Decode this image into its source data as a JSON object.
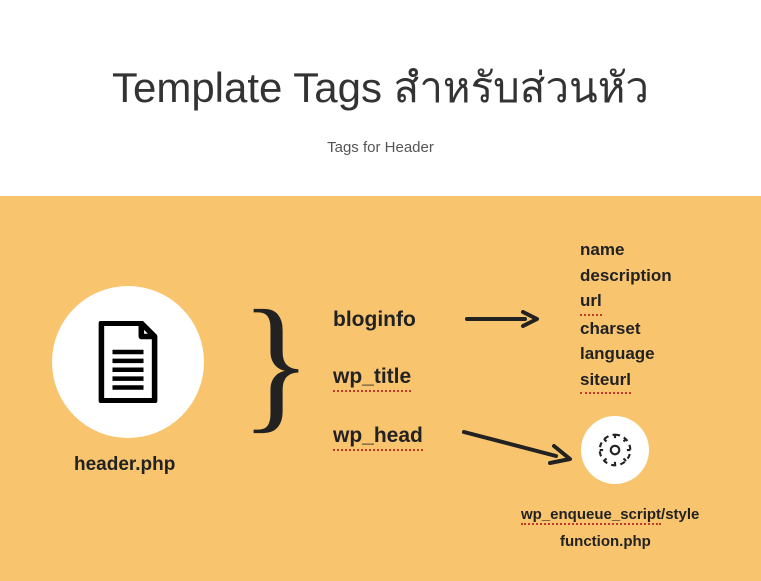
{
  "title": "Template Tags สำหรับส่วนหัว",
  "subtitle": "Tags for Header",
  "file_label": "header.php",
  "tags": {
    "bloginfo": "bloginfo",
    "wp_title": "wp_title",
    "wp_head": "wp_head"
  },
  "bloginfo_params": {
    "name": "name",
    "description": "description",
    "url": "url",
    "charset": "charset",
    "language": "language",
    "siteurl": "siteurl"
  },
  "wp_head_output": {
    "enqueue": "wp_enqueue_script",
    "enqueue_suffix": "/style",
    "function_file": "function.php"
  }
}
